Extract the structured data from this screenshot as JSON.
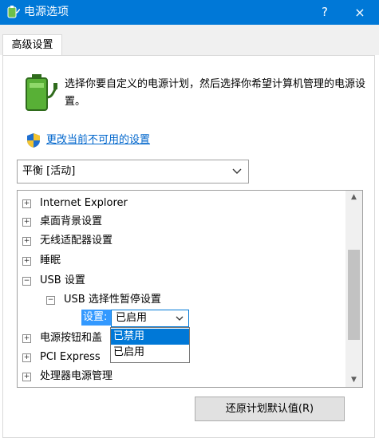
{
  "window": {
    "title": "电源选项",
    "help": "?",
    "close": "×"
  },
  "tab": {
    "label": "高级设置"
  },
  "description": "选择你要自定义的电源计划，然后选择你希望计算机管理的电源设置。",
  "link": "更改当前不可用的设置",
  "plan": {
    "selected": "平衡 [活动]"
  },
  "tree": {
    "items": [
      {
        "label": "Internet Explorer",
        "expander": "+"
      },
      {
        "label": "桌面背景设置",
        "expander": "+"
      },
      {
        "label": "无线适配器设置",
        "expander": "+"
      },
      {
        "label": "睡眠",
        "expander": "+"
      },
      {
        "label": "USB 设置",
        "expander": "−"
      },
      {
        "label": "USB 选择性暂停设置",
        "expander": "−"
      },
      {
        "label": "电源按钮和盖",
        "expander": "+"
      },
      {
        "label": "PCI Express",
        "expander": "+"
      },
      {
        "label": "处理器电源管理",
        "expander": "+"
      }
    ],
    "setting_label": "设置:",
    "setting_value": "已启用",
    "dropdown_options": [
      "已禁用",
      "已启用"
    ],
    "highlighted_option": "已禁用"
  },
  "restore_button": "还原计划默认值(R)",
  "colors": {
    "titlebar": "#0078d7",
    "link": "#0066cc",
    "highlight": "#0078d7"
  }
}
